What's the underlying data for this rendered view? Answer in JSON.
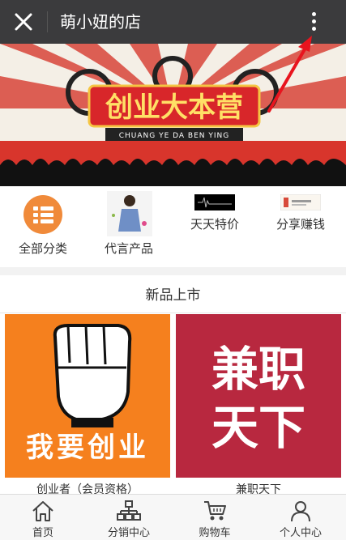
{
  "header": {
    "title": "萌小妞的店"
  },
  "banner": {
    "headline": "创业大本营",
    "subline": "CHUANG YE DA BEN YING"
  },
  "categories": [
    {
      "label": "全部分类",
      "icon": "list-icon"
    },
    {
      "label": "代言产品",
      "icon": "spokesperson-photo"
    },
    {
      "label": "天天特价",
      "icon": "daily-deal-thumbnail"
    },
    {
      "label": "分享赚钱",
      "icon": "share-earn-thumbnail"
    }
  ],
  "new_arrivals": {
    "title": "新品上市",
    "products": [
      {
        "image_text": "我要创业",
        "name": "创业者（会员资格）"
      },
      {
        "image_text_1": "兼职",
        "image_text_2": "天下",
        "name": "兼职天下"
      }
    ]
  },
  "bottom_nav": [
    {
      "label": "首页",
      "icon": "home-icon"
    },
    {
      "label": "分销中心",
      "icon": "distribution-icon"
    },
    {
      "label": "购物车",
      "icon": "cart-icon"
    },
    {
      "label": "个人中心",
      "icon": "user-icon"
    }
  ],
  "colors": {
    "topbar": "#3b3b3d",
    "accent_orange": "#f08a3a",
    "product1_bg": "#f5801e",
    "product2_bg": "#b8283f",
    "annotation_arrow": "#e8141e"
  }
}
